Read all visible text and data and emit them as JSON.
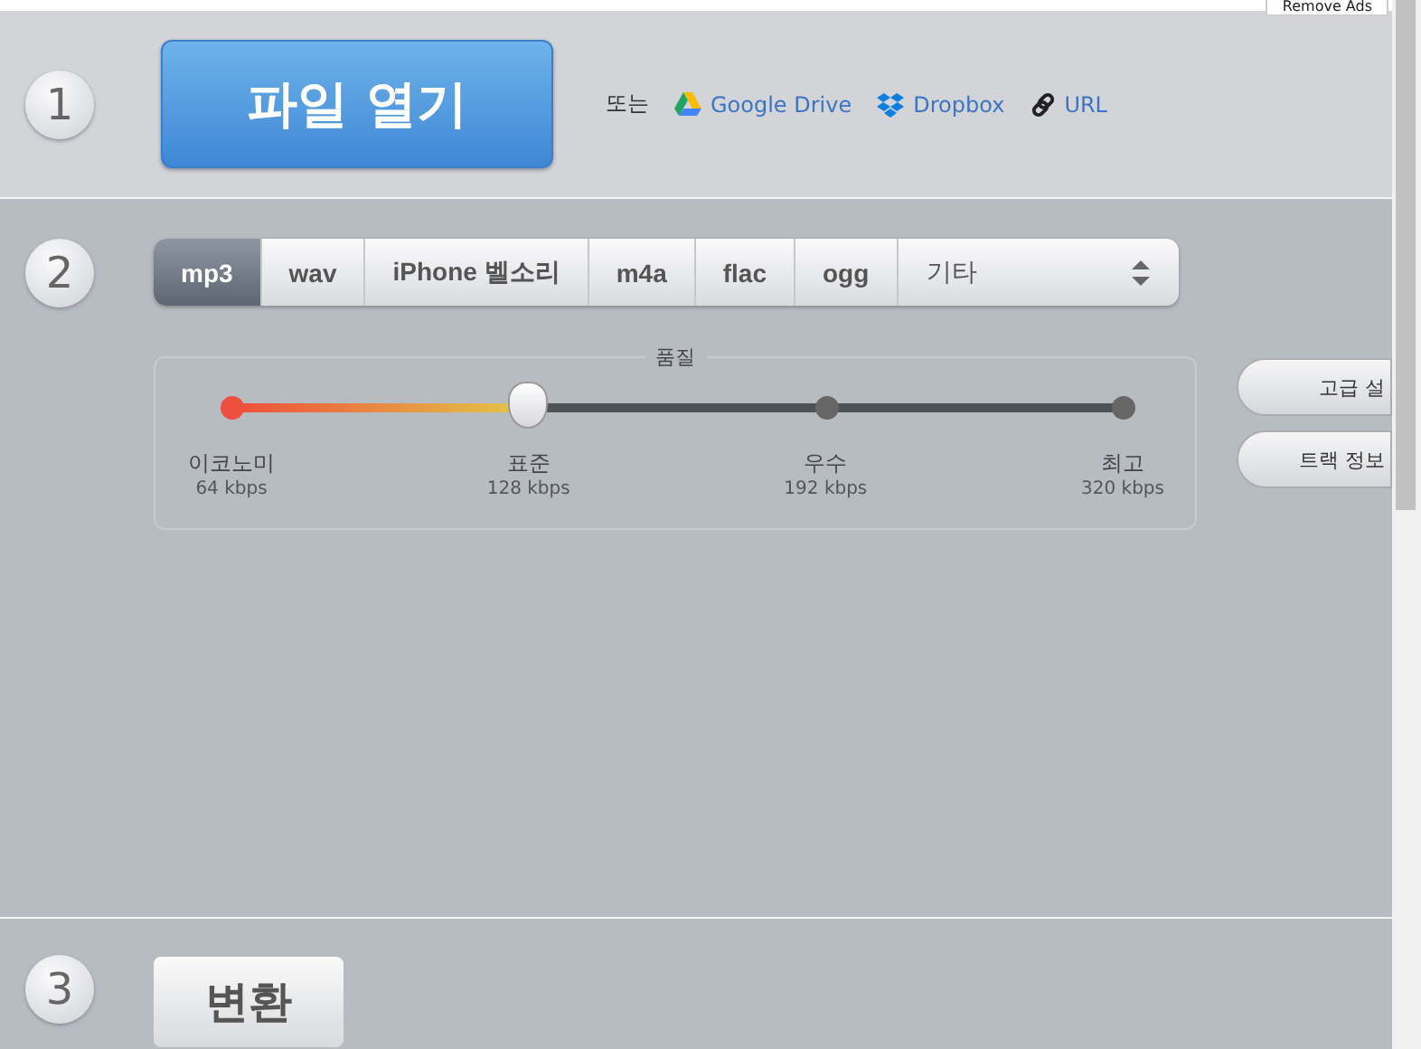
{
  "top_bar": {
    "remove_ads": "Remove Ads"
  },
  "steps": [
    {
      "number": "1"
    },
    {
      "number": "2"
    },
    {
      "number": "3"
    }
  ],
  "open_file": {
    "button": "파일 열기",
    "or": "또는",
    "sources": [
      {
        "kind": "drive",
        "label": "Google Drive"
      },
      {
        "kind": "dropbox",
        "label": "Dropbox"
      },
      {
        "kind": "link",
        "label": "URL"
      }
    ]
  },
  "formats": {
    "tabs": [
      {
        "label": "mp3",
        "selected": true
      },
      {
        "label": "wav",
        "selected": false
      },
      {
        "label": "iPhone 벨소리",
        "selected": false
      },
      {
        "label": "m4a",
        "selected": false
      },
      {
        "label": "flac",
        "selected": false
      },
      {
        "label": "ogg",
        "selected": false
      }
    ],
    "other": "기타"
  },
  "quality": {
    "title": "품질",
    "level": 0.333,
    "stops": [
      {
        "name": "이코노미",
        "rate": "64 kbps"
      },
      {
        "name": "표준",
        "rate": "128 kbps"
      },
      {
        "name": "우수",
        "rate": "192 kbps"
      },
      {
        "name": "최고",
        "rate": "320 kbps"
      }
    ]
  },
  "side_buttons": [
    "고급 설",
    "트랙 정보"
  ],
  "convert": {
    "button": "변환"
  }
}
